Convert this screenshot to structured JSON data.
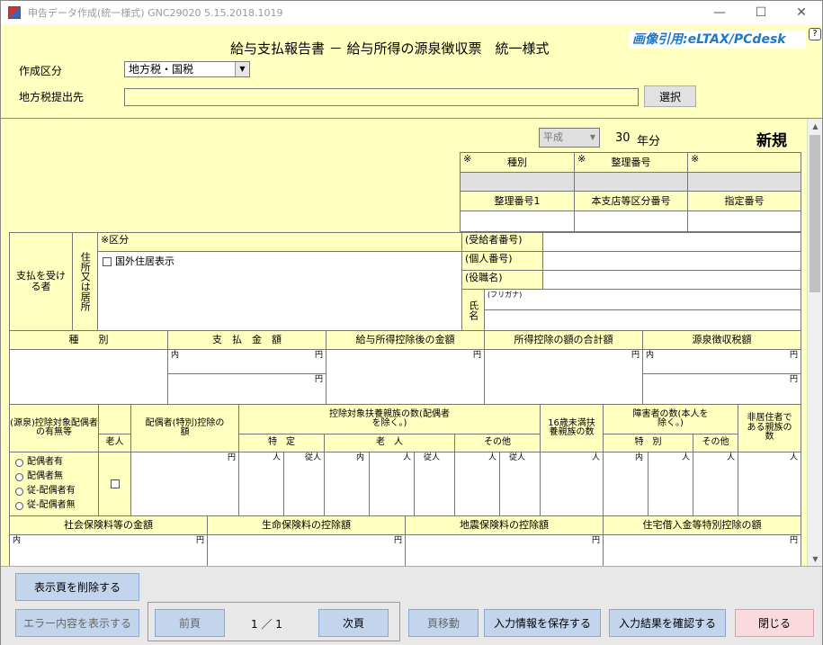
{
  "window": {
    "title": "申告データ作成(統一様式) GNC29020  5.15.2018.1019",
    "min": "—",
    "max": "☐",
    "close": "✕"
  },
  "header": {
    "form_title": "給与支払報告書 － 給与所得の源泉徴収票　統一様式",
    "watermark": "画像引用:eLTAX/PCdesk",
    "sakusei_label": "作成区分",
    "sakusei_value": "地方税・国税",
    "chiho_label": "地方税提出先",
    "chiho_value": "",
    "select_button": "選択"
  },
  "form": {
    "era": "平成",
    "year": "30",
    "year_suffix": "年分",
    "status": "新規",
    "top_grid": {
      "mark": "※",
      "shubetsu": "種別",
      "seiri": "整理番号",
      "seiri1": "整理番号1",
      "honshiten": "本支店等区分番号",
      "shitei": "指定番号"
    },
    "recipient": {
      "label": "支払を受ける者",
      "address_label": "住所又は居所",
      "kubun": "※区分",
      "kokugai": "国外住居表示",
      "jukyu": "(受給者番号)",
      "kojin": "(個人番号)",
      "yakushoku": "(役職名)",
      "shimei": "氏名",
      "furigana": "(フリガナ)"
    },
    "amounts": {
      "shubetsu": "種　　別",
      "shiharai": "支　払　金　額",
      "kyuyo": "給与所得控除後の金額",
      "kojo": "所得控除の額の合計額",
      "gensen": "源泉徴収税額",
      "uchi": "内",
      "en": "円"
    },
    "dependents": {
      "spouse_has": "(源泉)控除対象配偶者の有無等",
      "rojin": "老人",
      "spouse_deduction": "配偶者(特別)控除の額",
      "fuyo": "控除対象扶養親族の数(配偶者を除く。)",
      "tokutei": "特　定",
      "rojin2": "老　人",
      "sonota": "その他",
      "u16": "16歳未満扶養親族の数",
      "shogai": "障害者の数(本人を除く。)",
      "tokubetsu": "特　別",
      "sonota2": "その他",
      "hikyo": "非居住者である親族の数",
      "nin": "人",
      "juunin": "従人",
      "uchi": "内",
      "en": "円",
      "radio": [
        "配偶者有",
        "配偶者無",
        "従-配偶者有",
        "従-配偶者無"
      ]
    },
    "insurance": {
      "shakai": "社会保険料等の金額",
      "seimei": "生命保険料の控除額",
      "jishin": "地震保険料の控除額",
      "jutaku": "住宅借入金等特別控除の額",
      "uchi": "内",
      "en": "円"
    }
  },
  "footer": {
    "delete_page": "表示頁を削除する",
    "show_errors": "エラー内容を表示する",
    "prev": "前頁",
    "page": "1 ／ 1",
    "next": "次頁",
    "page_move": "頁移動",
    "save": "入力情報を保存する",
    "confirm": "入力結果を確認する",
    "close": "閉じる"
  }
}
